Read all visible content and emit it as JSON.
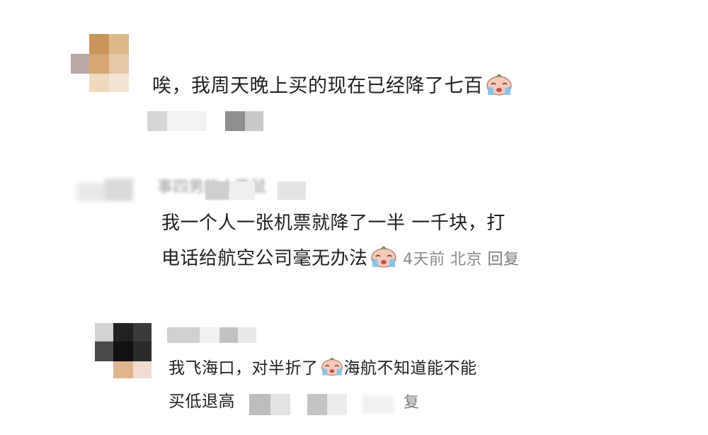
{
  "comments": [
    {
      "text": "唉，我周天晚上买的现在已经降了七百",
      "emoji": "crying-face-icon"
    },
    {
      "username_partial": "事四男的人撒鼠",
      "text_line1": "我一个人一张机票就降了一半 一千块，打",
      "text_line2": "电话给航空公司毫无办法",
      "emoji": "crying-face-icon",
      "time": "4天前",
      "location": "北京",
      "reply_label": "回复"
    },
    {
      "text_line1_a": "我飞海口，对半折了",
      "text_line1_b": "海航不知道能不能",
      "text_line2": "买低退高",
      "emoji": "crying-face-icon",
      "reply_label_partial": "复"
    }
  ],
  "colors": {
    "text": "#1f1f1f",
    "meta": "#8a8a8a",
    "background": "#ffffff"
  }
}
